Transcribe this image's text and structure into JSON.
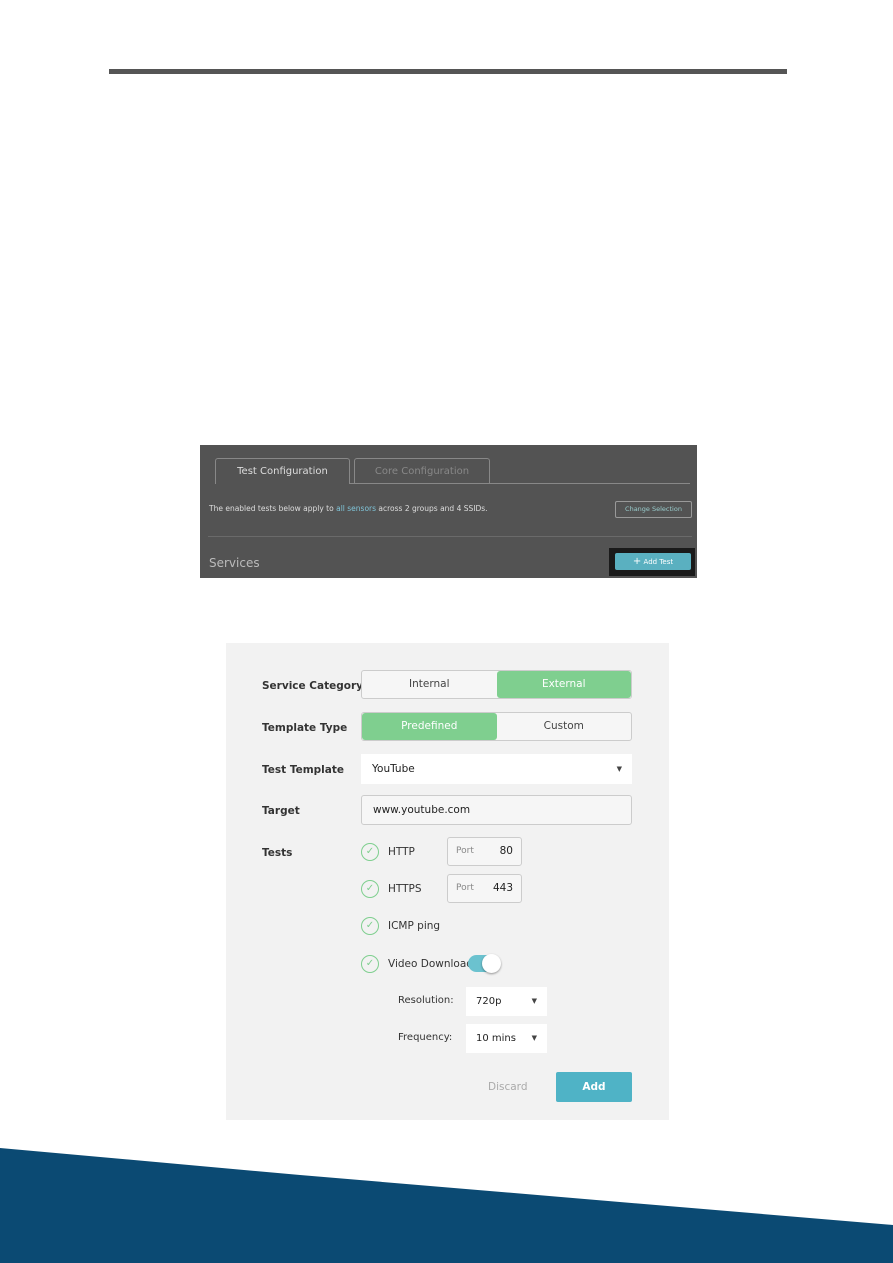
{
  "shot1": {
    "tabs": [
      {
        "label": "Test Configuration",
        "active": true
      },
      {
        "label": "Core Configuration",
        "active": false
      }
    ],
    "desc_before": "The enabled tests below apply to ",
    "desc_link": "all sensors",
    "desc_after": " across 2 groups and 4 SSIDs.",
    "change_selection": "Change Selection",
    "section": "Services",
    "add_test": "Add Test"
  },
  "shot2": {
    "service_category": {
      "label": "Service Category",
      "options": [
        "Internal",
        "External"
      ],
      "selected": "External"
    },
    "template_type": {
      "label": "Template Type",
      "options": [
        "Predefined",
        "Custom"
      ],
      "selected": "Predefined"
    },
    "test_template": {
      "label": "Test Template",
      "value": "YouTube"
    },
    "target": {
      "label": "Target",
      "value": "www.youtube.com"
    },
    "tests_label": "Tests",
    "tests": [
      {
        "name": "HTTP",
        "port_label": "Port",
        "port": "80"
      },
      {
        "name": "HTTPS",
        "port_label": "Port",
        "port": "443"
      },
      {
        "name": "ICMP ping"
      },
      {
        "name": "Video Download",
        "toggle": true
      }
    ],
    "resolution": {
      "label": "Resolution:",
      "value": "720p"
    },
    "frequency": {
      "label": "Frequency:",
      "value": "10 mins"
    },
    "discard": "Discard",
    "add": "Add"
  },
  "colors": {
    "accent_green": "#7fcf8f",
    "accent_teal": "#4fb3c6",
    "footer_blue": "#0b4a73"
  }
}
